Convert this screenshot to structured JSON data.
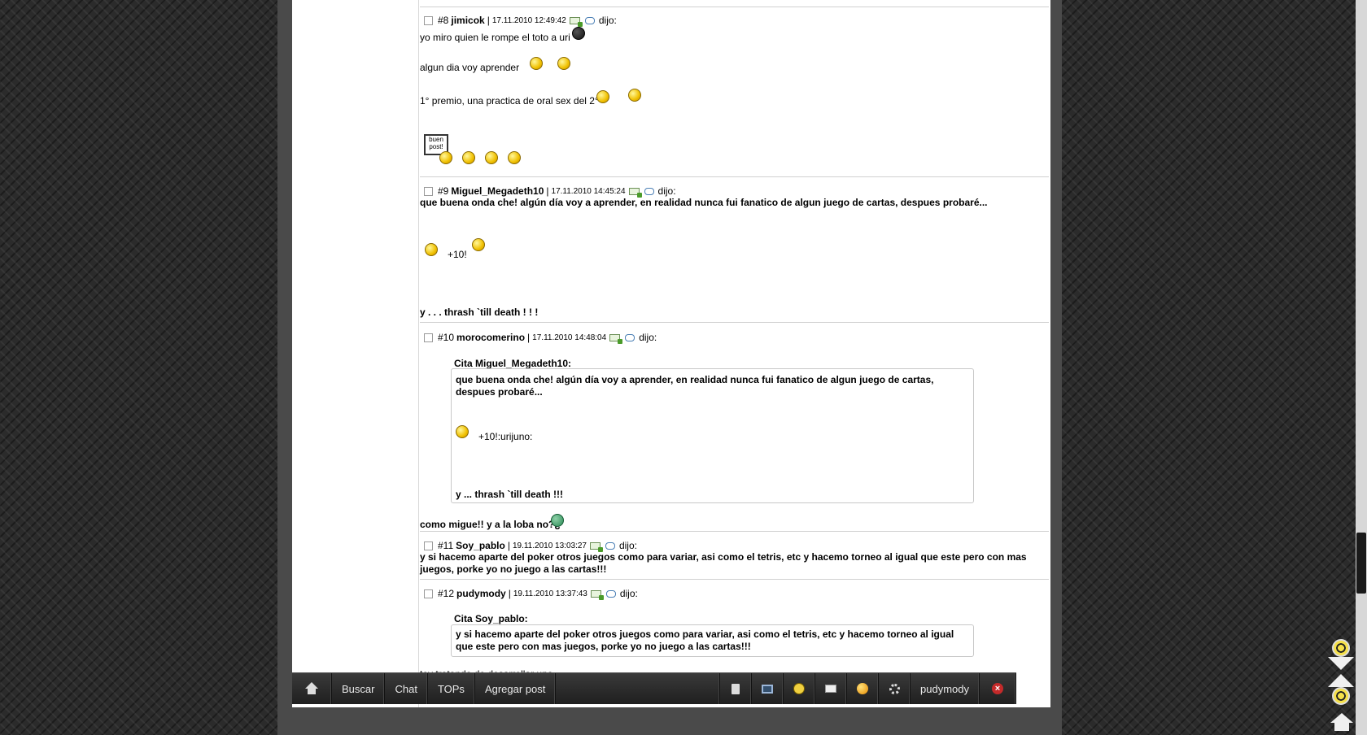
{
  "comments": [
    {
      "num": "#8",
      "user": "jimicok",
      "date": "17.11.2010 12:49:42",
      "dijo": "dijo:",
      "lines": [
        "yo miro quien le rompe el toto a uri",
        "algun dia voy aprender",
        "1° premio, una practica de oral sex del 2°"
      ],
      "sign_text": "buen post!"
    },
    {
      "num": "#9",
      "user": "Miguel_Megadeth10",
      "date": "17.11.2010 14:45:24",
      "dijo": "dijo:",
      "text": "que buena onda che! algún día voy a aprender, en realidad nunca fui fanatico de algun juego de cartas, despues probaré...",
      "plus": "+10!",
      "footer": "y . . . thrash `till death ! ! !"
    },
    {
      "num": "#10",
      "user": "morocomerino",
      "date": "17.11.2010 14:48:04",
      "dijo": "dijo:",
      "quote_label": "Cita Miguel_Megadeth10:",
      "quote_text": "que buena onda che! algún día voy a aprender, en realidad nunca fui fanatico de algun juego de cartas, despues probaré...",
      "quote_plus": "+10!:urijuno:",
      "quote_footer": "y ... thrash `till death !!!",
      "text": "como migue!! y a la loba no?¿"
    },
    {
      "num": "#11",
      "user": "Soy_pablo",
      "date": "19.11.2010 13:03:27",
      "dijo": "dijo:",
      "text": "y si hacemo aparte del poker otros juegos como para variar, asi como el tetris, etc y hacemo torneo al igual que este pero con mas juegos, porke yo no juego a las cartas!!!"
    },
    {
      "num": "#12",
      "user": "pudymody",
      "date": "19.11.2010 13:37:43",
      "dijo": "dijo:",
      "quote_label": "Cita Soy_pablo:",
      "quote_text": "y si hacemo aparte del poker otros juegos como para variar, asi como el tetris, etc y hacemo torneo al igual que este pero con mas juegos, porke yo no juego a las cartas!!!",
      "text": "toy tratando de desarrollar uno"
    }
  ],
  "taskbar": {
    "items": [
      "Buscar",
      "Chat",
      "TOPs",
      "Agregar post"
    ],
    "user": "pudymody",
    "close": "×",
    "icons": [
      "home-icon",
      "clipboard-icon",
      "window-icon",
      "trefoil-icon",
      "mail-icon",
      "smiley-icon",
      "gear-icon",
      "close-icon"
    ]
  },
  "colors": {
    "background": "#2b2b2b",
    "frame": "#4a4a4a",
    "taskbar": "#2a2a2a",
    "close": "#c42a2a"
  }
}
